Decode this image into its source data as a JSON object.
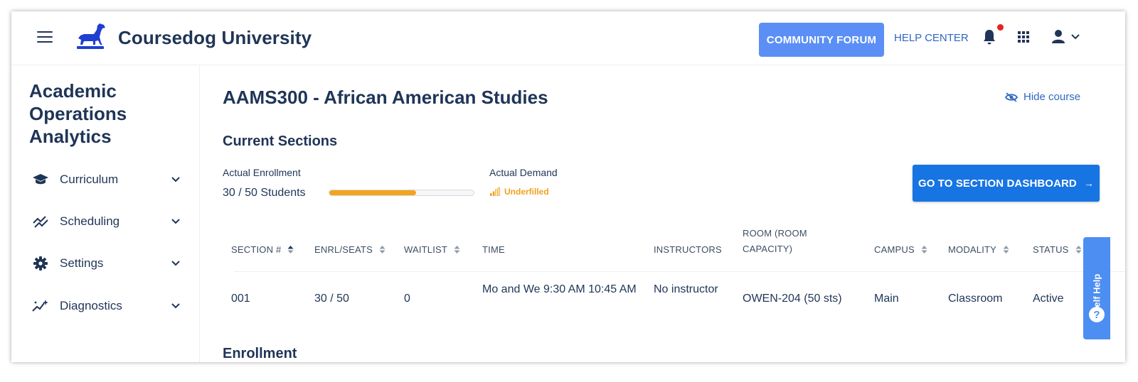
{
  "header": {
    "brand": "Coursedog University",
    "community_forum": "COMMUNITY FORUM",
    "help_center": "HELP CENTER"
  },
  "sidebar": {
    "title": "Academic Operations Analytics",
    "items": [
      {
        "label": "Curriculum",
        "icon": "graduation-cap-icon"
      },
      {
        "label": "Scheduling",
        "icon": "trend-lines-icon"
      },
      {
        "label": "Settings",
        "icon": "gear-icon"
      },
      {
        "label": "Diagnostics",
        "icon": "sparkle-trend-icon"
      }
    ]
  },
  "main": {
    "course_title": "AAMS300 - African American Studies",
    "hide_course": "Hide course",
    "current_sections": "Current Sections",
    "actual_enrollment_label": "Actual Enrollment",
    "actual_enrollment_value": "30 / 50 Students",
    "enrollment_fraction": 0.6,
    "actual_demand_label": "Actual Demand",
    "actual_demand_status": "Underfilled",
    "dashboard_button": "GO TO SECTION DASHBOARD",
    "enrollment_heading": "Enrollment"
  },
  "table": {
    "columns": [
      {
        "label": "SECTION #",
        "sortable": true
      },
      {
        "label": "ENRL/SEATS",
        "sortable": true
      },
      {
        "label": "WAITLIST",
        "sortable": true
      },
      {
        "label": "TIME",
        "sortable": false
      },
      {
        "label": "INSTRUCTORS",
        "sortable": false
      },
      {
        "label": "ROOM (ROOM CAPACITY)",
        "sortable": false
      },
      {
        "label": "CAMPUS",
        "sortable": true
      },
      {
        "label": "MODALITY",
        "sortable": true
      },
      {
        "label": "STATUS",
        "sortable": true
      }
    ],
    "rows": [
      {
        "section": "001",
        "enrl_seats": "30 / 50",
        "waitlist": "0",
        "time": "Mo and We 9:30 AM 10:45 AM",
        "instructors": "No instructor",
        "room": "OWEN-204 (50 sts)",
        "campus": "Main",
        "modality": "Classroom",
        "status": "Active"
      }
    ]
  },
  "self_help": {
    "label": "Self Help",
    "icon": "question-icon"
  },
  "colors": {
    "navy": "#1f3557",
    "link_blue": "#2f67c4",
    "forum_button": "#5b8ff6",
    "primary_button": "#1774e3",
    "progress": "#f4a41c",
    "underfilled": "#f0a020",
    "notification_dot": "#e8231e"
  }
}
